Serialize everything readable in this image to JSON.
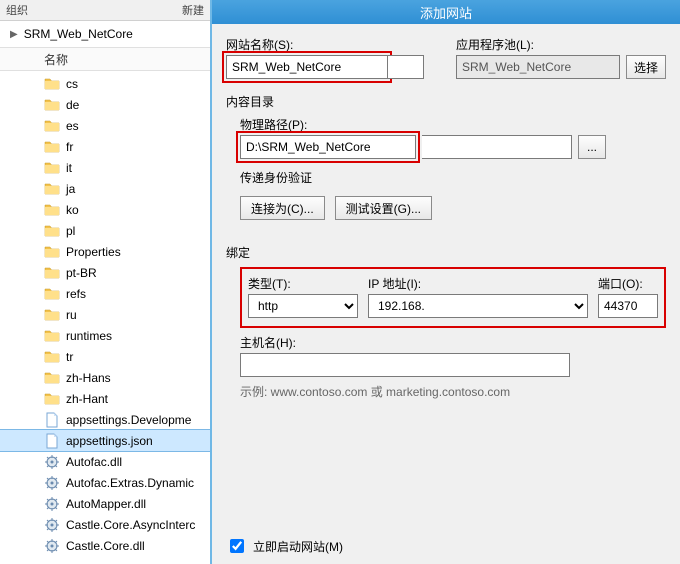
{
  "left": {
    "org_label": "组织",
    "new_label": "新建",
    "breadcrumb": "SRM_Web_NetCore",
    "col_name": "名称",
    "items": [
      {
        "name": "cs",
        "type": "folder"
      },
      {
        "name": "de",
        "type": "folder"
      },
      {
        "name": "es",
        "type": "folder"
      },
      {
        "name": "fr",
        "type": "folder"
      },
      {
        "name": "it",
        "type": "folder"
      },
      {
        "name": "ja",
        "type": "folder"
      },
      {
        "name": "ko",
        "type": "folder"
      },
      {
        "name": "pl",
        "type": "folder"
      },
      {
        "name": "Properties",
        "type": "folder"
      },
      {
        "name": "pt-BR",
        "type": "folder"
      },
      {
        "name": "refs",
        "type": "folder"
      },
      {
        "name": "ru",
        "type": "folder"
      },
      {
        "name": "runtimes",
        "type": "folder"
      },
      {
        "name": "tr",
        "type": "folder"
      },
      {
        "name": "zh-Hans",
        "type": "folder"
      },
      {
        "name": "zh-Hant",
        "type": "folder"
      },
      {
        "name": "appsettings.Developme",
        "type": "json"
      },
      {
        "name": "appsettings.json",
        "type": "json",
        "selected": true
      },
      {
        "name": "Autofac.dll",
        "type": "dll"
      },
      {
        "name": "Autofac.Extras.Dynamic",
        "type": "dll"
      },
      {
        "name": "AutoMapper.dll",
        "type": "dll"
      },
      {
        "name": "Castle.Core.AsyncInterc",
        "type": "dll"
      },
      {
        "name": "Castle.Core.dll",
        "type": "dll"
      }
    ]
  },
  "dlg": {
    "title": "添加网站",
    "site_name_label": "网站名称(S):",
    "site_name_value": "SRM_Web_NetCore",
    "app_pool_label": "应用程序池(L):",
    "app_pool_value": "SRM_Web_NetCore",
    "select_btn": "选择",
    "content_dir_label": "内容目录",
    "phys_path_label": "物理路径(P):",
    "phys_path_value": "D:\\SRM_Web_NetCore",
    "browse_btn": "...",
    "passthru_label": "传递身份验证",
    "connect_as_btn": "连接为(C)...",
    "test_settings_btn": "测试设置(G)...",
    "binding_label": "绑定",
    "type_label": "类型(T):",
    "type_value": "http",
    "ip_label": "IP 地址(I):",
    "ip_value": "192.168.",
    "port_label": "端口(O):",
    "port_value": "44370",
    "host_label": "主机名(H):",
    "host_value": "",
    "example": "示例: www.contoso.com 或 marketing.contoso.com",
    "start_now_label": "立即启动网站(M)"
  }
}
